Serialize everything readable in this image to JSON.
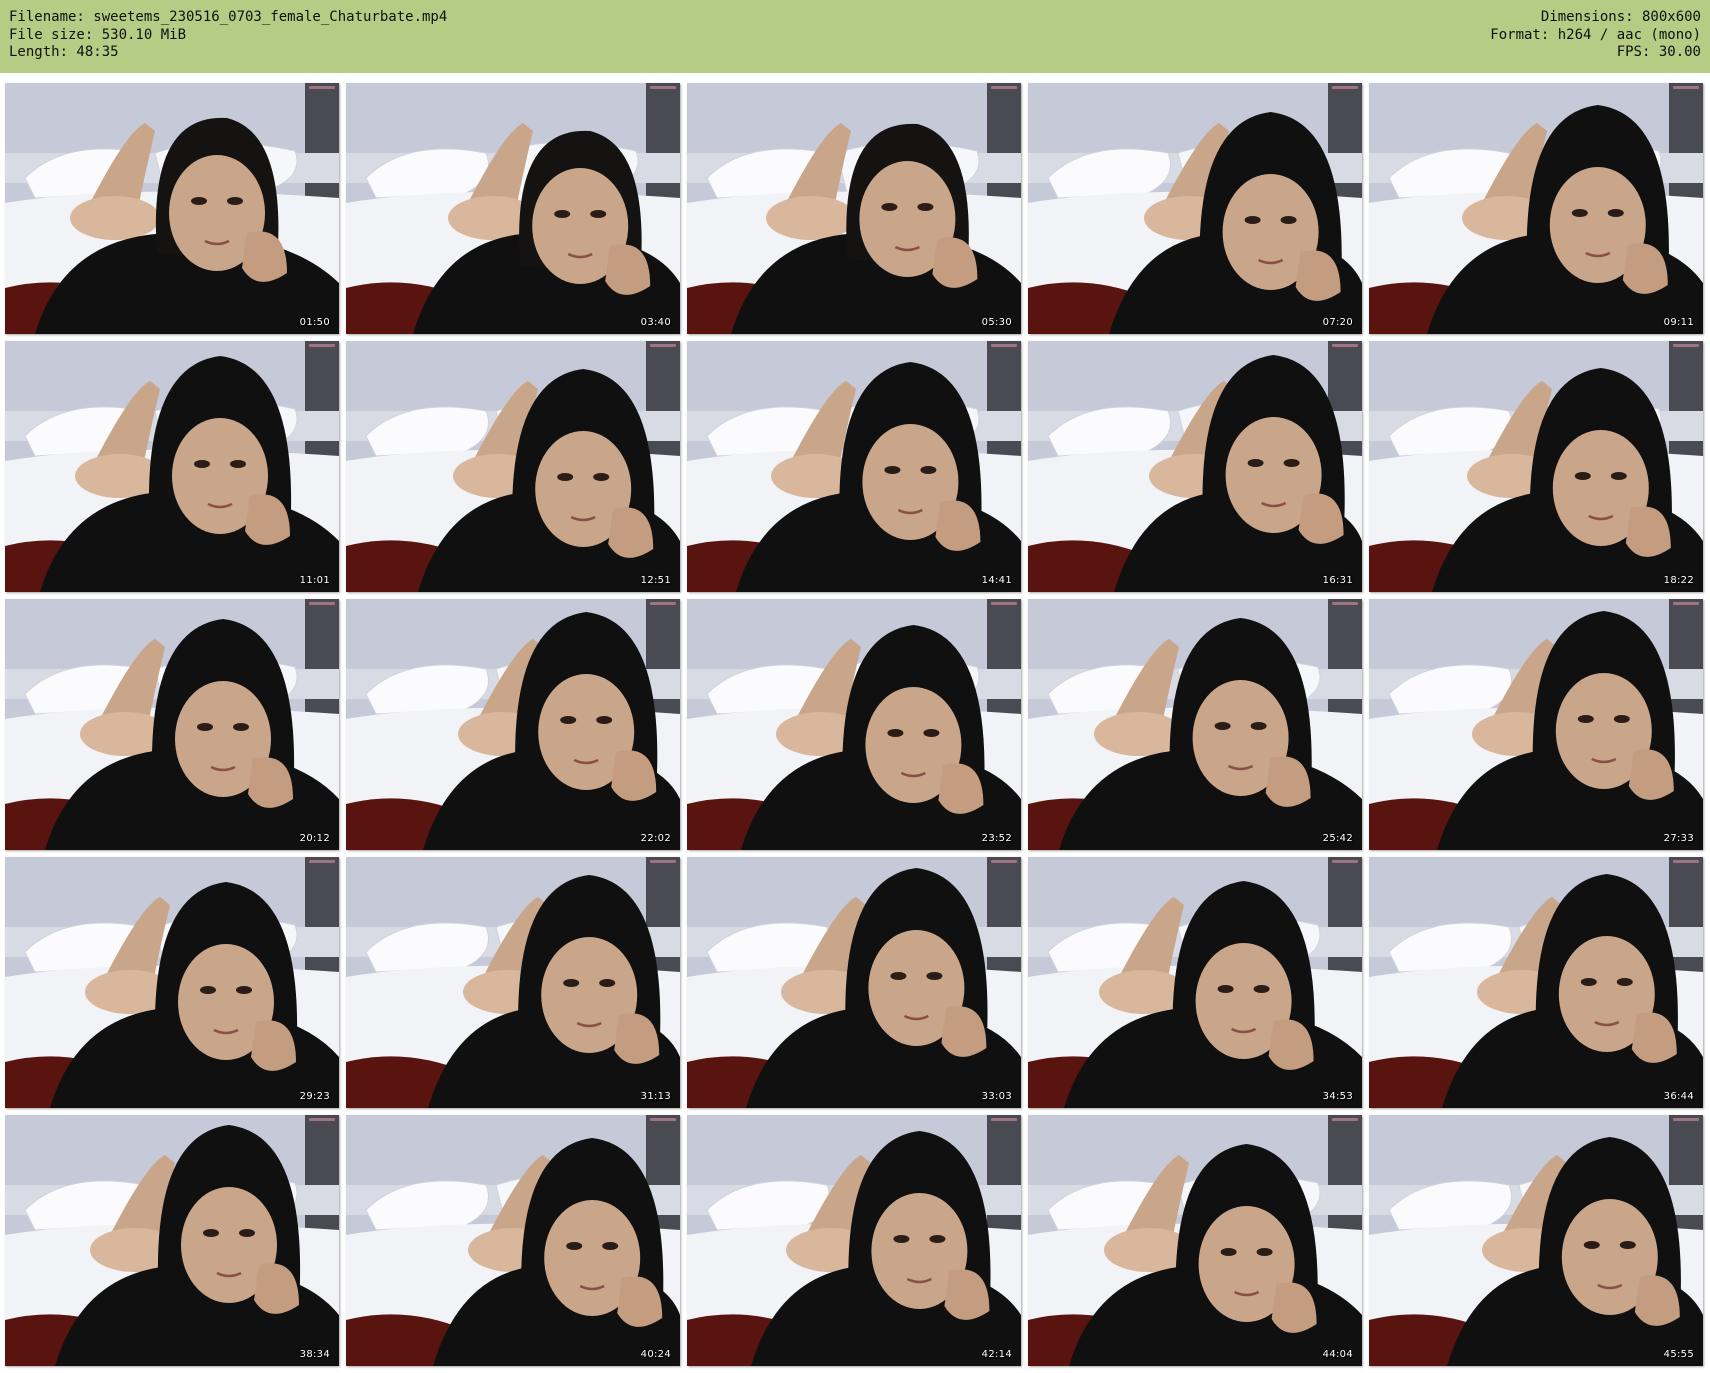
{
  "header": {
    "filename": "Filename: sweetems_230516_0703_female_Chaturbate.mp4",
    "filesize": "File size: 530.10 MiB",
    "length": "Length: 48:35",
    "dimensions": "Dimensions: 800x600",
    "format": "Format: h264 / aac (mono)",
    "fps": "FPS: 30.00"
  },
  "colors": {
    "header_bg": "#b4cc84",
    "wall": "#c5c9d8",
    "bedding": "#f2f3f6",
    "hoodie": "#101010",
    "skin": "#c9a58a",
    "sheet_red": "#5a1410"
  },
  "thumbnails": [
    {
      "time": "01:50",
      "hood": false
    },
    {
      "time": "03:40",
      "hood": false
    },
    {
      "time": "05:30",
      "hood": false
    },
    {
      "time": "07:20",
      "hood": true
    },
    {
      "time": "09:11",
      "hood": true
    },
    {
      "time": "11:01",
      "hood": true
    },
    {
      "time": "12:51",
      "hood": true
    },
    {
      "time": "14:41",
      "hood": true
    },
    {
      "time": "16:31",
      "hood": true
    },
    {
      "time": "18:22",
      "hood": true
    },
    {
      "time": "20:12",
      "hood": true
    },
    {
      "time": "22:02",
      "hood": true
    },
    {
      "time": "23:52",
      "hood": true
    },
    {
      "time": "25:42",
      "hood": true
    },
    {
      "time": "27:33",
      "hood": true
    },
    {
      "time": "29:23",
      "hood": true
    },
    {
      "time": "31:13",
      "hood": true
    },
    {
      "time": "33:03",
      "hood": true
    },
    {
      "time": "34:53",
      "hood": true
    },
    {
      "time": "36:44",
      "hood": true
    },
    {
      "time": "38:34",
      "hood": true
    },
    {
      "time": "40:24",
      "hood": true
    },
    {
      "time": "42:14",
      "hood": true
    },
    {
      "time": "44:04",
      "hood": true
    },
    {
      "time": "45:55",
      "hood": true
    }
  ]
}
